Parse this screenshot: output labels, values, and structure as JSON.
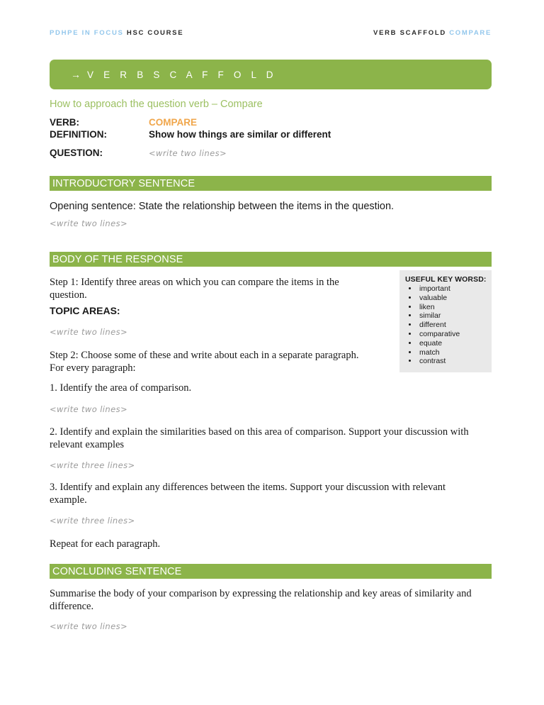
{
  "running_head": {
    "left_light": "PDHPE IN FOCUS",
    "left_dark": "HSC COURSE",
    "right_dark": "VERB SCAFFOLD",
    "right_light": "COMPARE"
  },
  "banner": {
    "arrow_icon": "→",
    "title": "V E R B  S C A F F O L D"
  },
  "subtitle": "How to approach the question verb – Compare",
  "verb_block": {
    "verb_label": "VERB:",
    "verb_value": "COMPARE",
    "definition_label": "DEFINITION:",
    "definition_value": "Show how things are similar or different",
    "question_label": "QUESTION:",
    "question_placeholder": "<write two lines>"
  },
  "sections": {
    "intro": {
      "heading": "INTRODUCTORY SENTENCE",
      "text": "Opening sentence: State the relationship between the items in the question.",
      "placeholder": "<write two lines>"
    },
    "body": {
      "heading": "BODY OF THE RESPONSE",
      "step1": "Step 1: Identify three areas on which you can compare the items in the question.",
      "topic_areas_label": "TOPIC AREAS:",
      "topic_areas_placeholder": "<write two lines>",
      "step2": "Step 2: Choose some of these and write about each in a separate paragraph. For every paragraph:",
      "point1": "1. Identify the area of comparison.",
      "point1_placeholder": "<write two lines>",
      "point2": "2. Identify and explain the similarities based on this area of comparison. Support your discussion with relevant examples",
      "point2_placeholder": "<write three lines>",
      "point3": "3. Identify and explain any differences between the items. Support your discussion with relevant example.",
      "point3_placeholder": "<write three lines>",
      "repeat": "Repeat for each paragraph."
    },
    "conclusion": {
      "heading": "CONCLUDING SENTENCE",
      "text": "Summarise the body of your comparison by expressing the relationship and key areas of similarity and difference.",
      "placeholder": "<write two lines>"
    }
  },
  "key_words_box": {
    "title": "USEFUL KEY WORSD:",
    "items": [
      "important",
      "valuable",
      "liken",
      "similar",
      "different",
      "comparative",
      "equate",
      "match",
      "contrast"
    ]
  },
  "colors": {
    "green": "#8cb44a",
    "green_light": "#9cc062",
    "orange": "#f0a64b",
    "blue_light": "#93c7ec",
    "grey_box": "#e9e9e9",
    "hand_grey": "#9b9b9b"
  }
}
